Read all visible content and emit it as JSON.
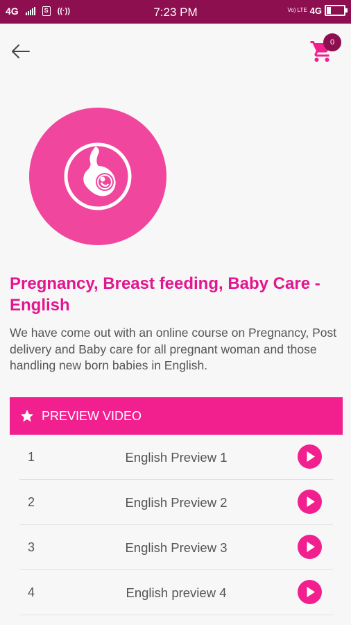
{
  "status_bar": {
    "network": "4G",
    "time": "7:23 PM",
    "volte": "Vo) LTE",
    "network_right": "4G"
  },
  "header": {
    "back_icon": "arrow-left-icon",
    "cart_icon": "shopping-cart-icon",
    "cart_count": "0"
  },
  "course": {
    "logo_icon": "pregnancy-icon",
    "title": "Pregnancy, Breast feeding, Baby Care - English",
    "description": "We have come out with an online course on Pregnancy, Post delivery and Baby care for all pregnant woman and those handling new born babies in English."
  },
  "preview": {
    "icon": "star-icon",
    "label": "PREVIEW VIDEO",
    "items": [
      {
        "num": "1",
        "name": "English Preview 1"
      },
      {
        "num": "2",
        "name": "English Preview 2"
      },
      {
        "num": "3",
        "name": "English Preview 3"
      },
      {
        "num": "4",
        "name": "English preview 4"
      }
    ]
  },
  "colors": {
    "status_bar": "#8e0f4f",
    "accent": "#f21f8f",
    "title": "#e3158f",
    "logo": "#f0469e"
  }
}
